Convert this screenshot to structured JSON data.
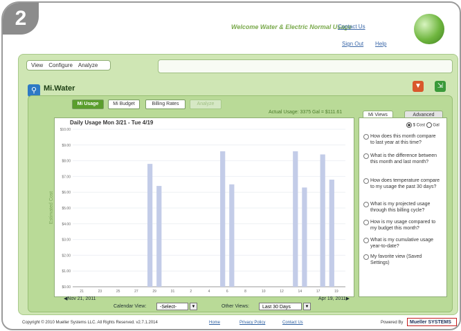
{
  "step_number": "2",
  "header": {
    "welcome_text": "Welcome Water & Electric Normal Usage",
    "contact_link": "Contact Us",
    "signout_link": "Sign Out",
    "help_link": "Help"
  },
  "menu": {
    "items": [
      "View",
      "Configure",
      "Analyze"
    ]
  },
  "app": {
    "brand": "Mi.Water"
  },
  "tabs": [
    {
      "label": "Mi Usage",
      "active": true
    },
    {
      "label": "Mi Budget",
      "active": false
    },
    {
      "label": "Billing Rates",
      "active": false
    },
    {
      "label": "Analyze",
      "active": false,
      "disabled": true
    }
  ],
  "usage_summary": "Actual Usage: 3375 Gal = $111.61",
  "chart_data": {
    "type": "bar",
    "title": "Daily Usage Mon 3/21 - Tue 4/19",
    "ylabel": "Estimated Cost",
    "ylim": [
      0,
      10
    ],
    "yticks": [
      "$10.00",
      "$9.00",
      "$8.00",
      "$7.00",
      "$6.00",
      "$5.00",
      "$4.00",
      "$3.00",
      "$2.00",
      "$1.00",
      "$0.00"
    ],
    "categories": [
      "3/21",
      "3/22",
      "3/23",
      "3/24",
      "3/25",
      "3/26",
      "3/27",
      "3/28",
      "3/29",
      "3/30",
      "3/31",
      "4/1",
      "4/2",
      "4/3",
      "4/4",
      "4/5",
      "4/6",
      "4/7",
      "4/8",
      "4/9",
      "4/10",
      "4/11",
      "4/12",
      "4/13",
      "4/14",
      "4/15",
      "4/16",
      "4/17",
      "4/18",
      "4/19"
    ],
    "values": [
      0,
      0,
      0,
      0,
      0,
      0,
      0,
      0,
      7.8,
      6.4,
      0,
      0,
      0,
      0,
      0,
      0,
      8.6,
      6.5,
      0,
      0,
      0,
      0,
      0,
      0,
      8.6,
      6.3,
      0,
      0,
      0,
      0
    ],
    "values_2": [
      0,
      0,
      0,
      0,
      0,
      0,
      0,
      0,
      0,
      0,
      0,
      0,
      0,
      0,
      0,
      0,
      0,
      0,
      0,
      0,
      0,
      0,
      0,
      0,
      0,
      0,
      0,
      8.4,
      6.8,
      0
    ],
    "xtick_labels": [
      "21",
      "23",
      "25",
      "27",
      "29",
      "31",
      "2",
      "4",
      "6",
      "8",
      "10",
      "12",
      "14",
      "17",
      "19"
    ],
    "x_start_label": "Nov 21, 2011",
    "x_end_label": "Apr 19, 2011",
    "bar_color": "#c3cce8"
  },
  "controls": {
    "calendar_view_label": "Calendar View:",
    "calendar_view_value": "-Select-",
    "other_views_label": "Other Views:",
    "other_views_value": "Last 30 Days"
  },
  "right_panel": {
    "tabs": [
      "Mi Views",
      "Advanced"
    ],
    "units": [
      "$ Cost",
      "Gal"
    ],
    "questions": [
      "How does this month compare to last year at this time?",
      "What is the difference between this month and last month?",
      "How does temperature compare to my usage the past 30 days?",
      "What is my projected usage through this billing cycle?",
      "How is my usage compared to my budget this month?",
      "What is my cumulative usage year-to-date?",
      "My favorite view (Saved Settings)"
    ]
  },
  "footer": {
    "copyright": "Copyright © 2010 Mueller Systems LLC. All Rights Reserved. v2.7.1.2014",
    "links": [
      "Home",
      "Privacy Policy",
      "Contact Us"
    ],
    "powered_by": "Powered By",
    "logo_text": "Mueller SYSTEMS"
  },
  "colors": {
    "accent": "#5a9e2c",
    "panel": "#cfe6b4",
    "bars": "#c3cce8"
  }
}
